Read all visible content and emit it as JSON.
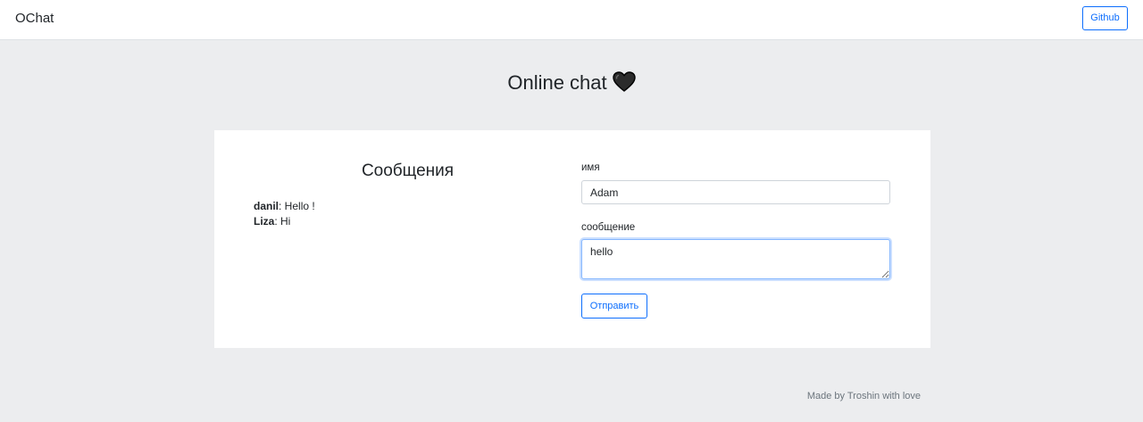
{
  "navbar": {
    "brand": "OChat",
    "github_label": "Github"
  },
  "header": {
    "title": "Online chat",
    "icon": "black-heart-icon"
  },
  "messages": {
    "title": "Сообщения",
    "items": [
      {
        "author": "danil",
        "text": ": Hello !"
      },
      {
        "author": "Liza",
        "text": ": Hi"
      }
    ]
  },
  "form": {
    "name_label": "имя",
    "name_value": "Adam",
    "message_label": "сообщение",
    "message_value": "hello",
    "submit_label": "Отправить"
  },
  "footer": {
    "text": "Made by Troshin with love"
  },
  "colors": {
    "accent": "#0d6efd",
    "background": "#ecedef"
  }
}
